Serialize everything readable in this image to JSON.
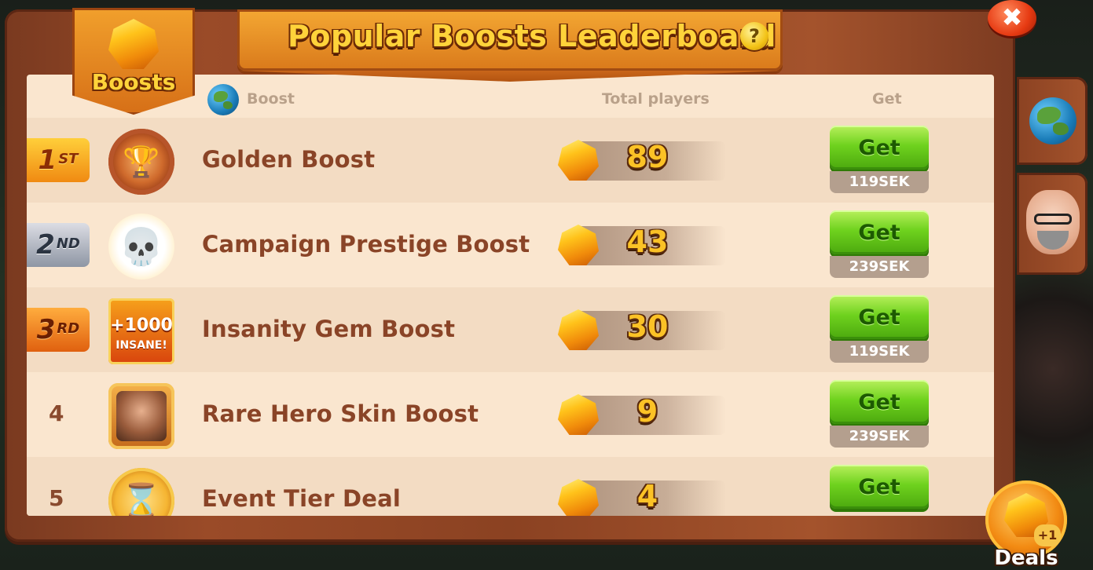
{
  "title": "Popular Boosts Leaderboard",
  "help_label": "?",
  "tab_label": "Boosts",
  "close_label": "✖",
  "headers": {
    "boost": "Boost",
    "total_players": "Total players",
    "get": "Get"
  },
  "rows": [
    {
      "rank": "1",
      "rank_suffix": "ST",
      "name": "Golden Boost",
      "players": "89",
      "button": "Get",
      "price": "119SEK",
      "icon": "trophy-icon"
    },
    {
      "rank": "2",
      "rank_suffix": "ND",
      "name": "Campaign Prestige Boost",
      "players": "43",
      "button": "Get",
      "price": "239SEK",
      "icon": "skull-icon"
    },
    {
      "rank": "3",
      "rank_suffix": "RD",
      "name": "Insanity Gem Boost",
      "players": "30",
      "button": "Get",
      "price": "119SEK",
      "icon": "insane-icon",
      "icon_text_1": "+1000",
      "icon_text_2": "INSANE!"
    },
    {
      "rank": "4",
      "name": "Rare Hero Skin Boost",
      "players": "9",
      "button": "Get",
      "price": "239SEK",
      "icon": "hero-portrait-icon"
    },
    {
      "rank": "5",
      "name": "Event Tier Deal",
      "players": "4",
      "button": "Get",
      "icon": "hourglass-icon"
    }
  ],
  "deals": {
    "label": "Deals",
    "badge": "+1"
  },
  "colors": {
    "panel": "#fae6cf",
    "get_button": "#6fd21e",
    "title_text": "#ffd33a",
    "wood": "#8b4222"
  }
}
